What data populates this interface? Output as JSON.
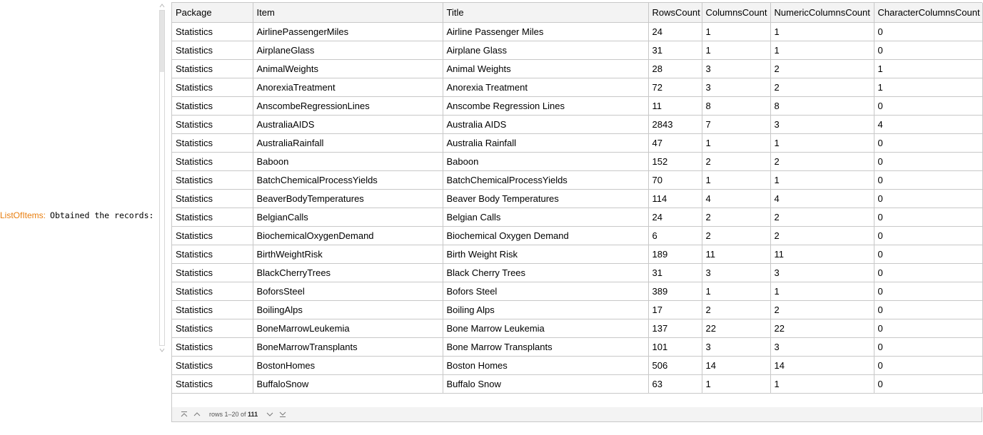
{
  "message": {
    "tag": "ListOfItems:",
    "text": "Obtained the records:"
  },
  "table": {
    "columns": [
      "Package",
      "Item",
      "Title",
      "RowsCount",
      "ColumnsCount",
      "NumericColumnsCount",
      "CharacterColumnsCount"
    ],
    "rows": [
      [
        "Statistics",
        "AirlinePassengerMiles",
        "Airline Passenger Miles",
        "24",
        "1",
        "1",
        "0"
      ],
      [
        "Statistics",
        "AirplaneGlass",
        "Airplane Glass",
        "31",
        "1",
        "1",
        "0"
      ],
      [
        "Statistics",
        "AnimalWeights",
        "Animal Weights",
        "28",
        "3",
        "2",
        "1"
      ],
      [
        "Statistics",
        "AnorexiaTreatment",
        "Anorexia Treatment",
        "72",
        "3",
        "2",
        "1"
      ],
      [
        "Statistics",
        "AnscombeRegressionLines",
        "Anscombe Regression Lines",
        "11",
        "8",
        "8",
        "0"
      ],
      [
        "Statistics",
        "AustraliaAIDS",
        "Australia AIDS",
        "2843",
        "7",
        "3",
        "4"
      ],
      [
        "Statistics",
        "AustraliaRainfall",
        "Australia Rainfall",
        "47",
        "1",
        "1",
        "0"
      ],
      [
        "Statistics",
        "Baboon",
        "Baboon",
        "152",
        "2",
        "2",
        "0"
      ],
      [
        "Statistics",
        "BatchChemicalProcessYields",
        "BatchChemicalProcessYields",
        "70",
        "1",
        "1",
        "0"
      ],
      [
        "Statistics",
        "BeaverBodyTemperatures",
        "Beaver Body Temperatures",
        "114",
        "4",
        "4",
        "0"
      ],
      [
        "Statistics",
        "BelgianCalls",
        "Belgian Calls",
        "24",
        "2",
        "2",
        "0"
      ],
      [
        "Statistics",
        "BiochemicalOxygenDemand",
        "Biochemical Oxygen Demand",
        "6",
        "2",
        "2",
        "0"
      ],
      [
        "Statistics",
        "BirthWeightRisk",
        "Birth Weight Risk",
        "189",
        "11",
        "11",
        "0"
      ],
      [
        "Statistics",
        "BlackCherryTrees",
        "Black Cherry Trees",
        "31",
        "3",
        "3",
        "0"
      ],
      [
        "Statistics",
        "BoforsSteel",
        "Bofors Steel",
        "389",
        "1",
        "1",
        "0"
      ],
      [
        "Statistics",
        "BoilingAlps",
        "Boiling Alps",
        "17",
        "2",
        "2",
        "0"
      ],
      [
        "Statistics",
        "BoneMarrowLeukemia",
        "Bone Marrow Leukemia",
        "137",
        "22",
        "22",
        "0"
      ],
      [
        "Statistics",
        "BoneMarrowTransplants",
        "Bone Marrow Transplants",
        "101",
        "3",
        "3",
        "0"
      ],
      [
        "Statistics",
        "BostonHomes",
        "Boston Homes",
        "506",
        "14",
        "14",
        "0"
      ],
      [
        "Statistics",
        "BuffaloSnow",
        "Buffalo Snow",
        "63",
        "1",
        "1",
        "0"
      ]
    ]
  },
  "pager": {
    "prefix": "rows 1–20 of",
    "total": "111"
  },
  "icons": {
    "first": "first-page-icon",
    "prev": "previous-page-icon",
    "next": "next-page-icon",
    "last": "last-page-icon",
    "scroll_up": "scroll-up-icon",
    "scroll_down": "scroll-down-icon"
  },
  "colors": {
    "tag": "#e87d0d",
    "header_bg": "#f3f3f3",
    "grid_line": "#c8c8c8"
  }
}
